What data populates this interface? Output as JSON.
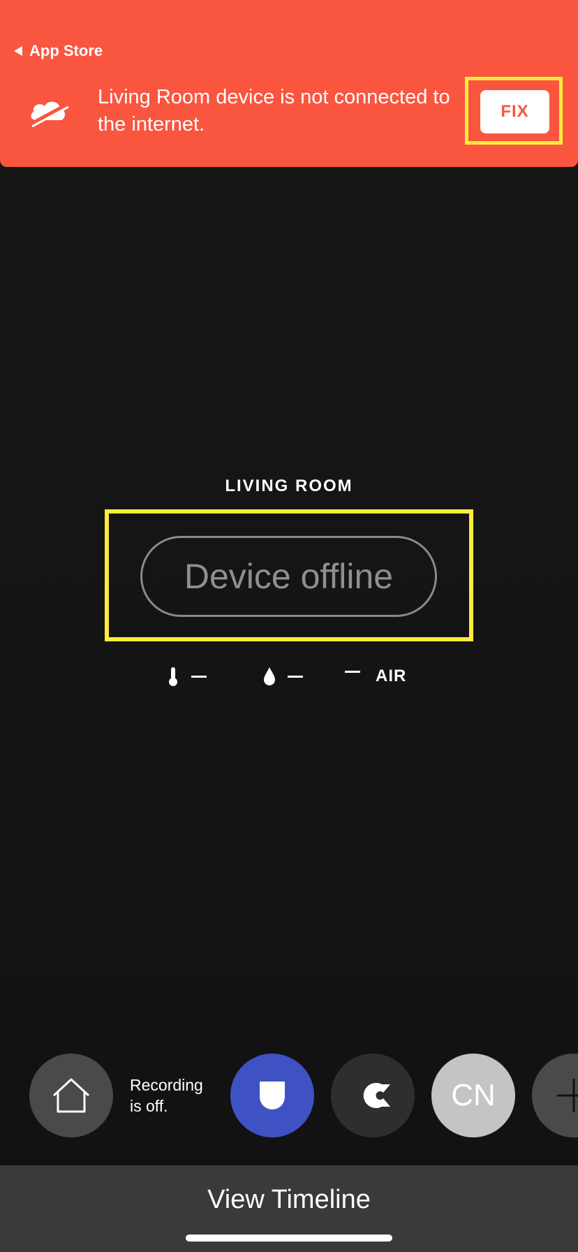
{
  "banner": {
    "back_label": "App Store",
    "message": "Living Room device is not connected to the internet.",
    "fix_label": "FIX",
    "background_color": "#f9553f",
    "icon": "cloud-offline-icon"
  },
  "device": {
    "room_name": "LIVING ROOM",
    "status": "Device offline",
    "temperature": "—",
    "humidity": "—",
    "air_value": "—",
    "air_label": "AIR"
  },
  "controls": {
    "recording_text_line1": "Recording",
    "recording_text_line2": "is off.",
    "user_initials": "CN",
    "accent_color": "#3f52c4"
  },
  "footer": {
    "timeline_label": "View Timeline"
  }
}
